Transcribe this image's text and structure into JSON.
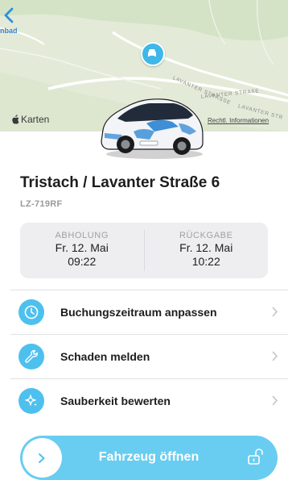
{
  "map": {
    "place_label": "nbad",
    "streets": [
      "LAVANTER STRASSE",
      "LAVANTER STRAßE",
      "LAVANTER STR"
    ],
    "brand": "Karten",
    "legal_link": "Rechtl. Informationen"
  },
  "vehicle": {
    "title": "Tristach / Lavanter Straße 6",
    "plate": "LZ-719RF"
  },
  "booking": {
    "pickup": {
      "label": "ABHOLUNG",
      "date": "Fr. 12. Mai",
      "time": "09:22"
    },
    "return": {
      "label": "RÜCKGABE",
      "date": "Fr. 12. Mai",
      "time": "10:22"
    }
  },
  "actions": [
    {
      "label": "Buchungszeitraum anpassen",
      "icon": "clock-icon"
    },
    {
      "label": "Schaden melden",
      "icon": "wrench-icon"
    },
    {
      "label": "Sauberkeit bewerten",
      "icon": "sparkle-icon"
    }
  ],
  "open_button": {
    "label": "Fahrzeug öffnen"
  },
  "colors": {
    "accent": "#4ec0ee",
    "open_bar": "#68cdf1",
    "back": "#2f8ee0"
  }
}
